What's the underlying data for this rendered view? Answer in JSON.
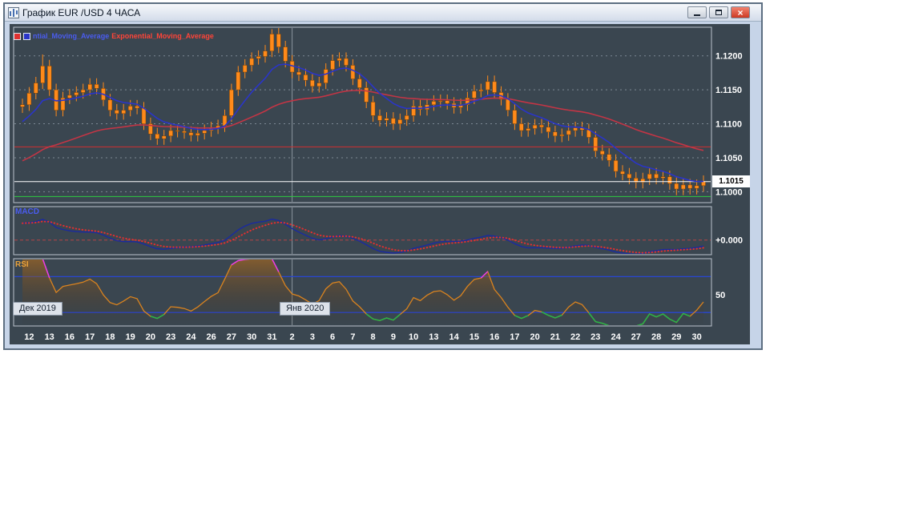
{
  "window": {
    "title": "График EUR /USD 4 ЧАСА"
  },
  "legend": {
    "ema_fast_label": "ntial_Moving_Average",
    "ema_slow_label": "Exponential_Moving_Average"
  },
  "panels": {
    "macd_label": "MACD",
    "macd_axis_label": "+0.000",
    "rsi_label": "RSI",
    "rsi_axis_label": "50"
  },
  "price_axis": {
    "labels": [
      "1.1200",
      "1.1150",
      "1.1100",
      "1.1050",
      "1.1000"
    ],
    "current_price": "1.1015"
  },
  "date_badges": [
    "Дек 2019",
    "Янв 2020"
  ],
  "colors": {
    "background": "#3a4650",
    "panel_border": "#b9c2cc",
    "grid": "#9aa6b2",
    "candle": "#ff8a1a",
    "candle_outline": "#7a4205",
    "ema_fast": "#2a35c8",
    "ema_slow": "#c23545",
    "red_line": "#d23030",
    "white_line": "#ffffff",
    "green_line": "#2ecc40",
    "macd_line": "#1a2aa0",
    "macd_signal": "#e03030",
    "macd_zero": "#cc4444",
    "rsi_line": "#d9831f",
    "rsi_overbought": "#e83ce8",
    "rsi_oversold": "#28b448",
    "rsi_level": "#2846d2",
    "axis_text": "#ffffff"
  },
  "chart_data": {
    "type": "candlestick",
    "title": "EUR/USD 4 часа — свечи с EMA, MACD, RSI",
    "x_labels": [
      "12",
      "13",
      "16",
      "17",
      "18",
      "19",
      "20",
      "23",
      "24",
      "26",
      "27",
      "30",
      "31",
      "2",
      "3",
      "6",
      "7",
      "8",
      "9",
      "10",
      "13",
      "14",
      "15",
      "16",
      "17",
      "20",
      "21",
      "22",
      "23",
      "24",
      "27",
      "28",
      "29",
      "30"
    ],
    "candles_per_label": 3,
    "pre_closes": [
      1.1005,
      1.102,
      1.1038,
      1.1055,
      1.107,
      1.1082,
      1.1095,
      1.1105,
      1.1112,
      1.1118,
      1.1122,
      1.1125
    ],
    "closes": [
      1.1128,
      1.1145,
      1.116,
      1.1185,
      1.115,
      1.112,
      1.1138,
      1.1142,
      1.1146,
      1.115,
      1.1158,
      1.1152,
      1.1135,
      1.112,
      1.1115,
      1.112,
      1.1126,
      1.1123,
      1.11,
      1.1085,
      1.1078,
      1.1082,
      1.109,
      1.1089,
      1.1087,
      1.1083,
      1.1086,
      1.109,
      1.1094,
      1.1097,
      1.1112,
      1.115,
      1.1176,
      1.1186,
      1.1196,
      1.1199,
      1.1207,
      1.1232,
      1.1213,
      1.1192,
      1.1176,
      1.1172,
      1.1164,
      1.1155,
      1.116,
      1.118,
      1.1193,
      1.1196,
      1.1186,
      1.1166,
      1.1153,
      1.1132,
      1.1112,
      1.1105,
      1.1108,
      1.11,
      1.1106,
      1.1112,
      1.1126,
      1.1121,
      1.1128,
      1.1133,
      1.1134,
      1.113,
      1.1124,
      1.1128,
      1.1138,
      1.1148,
      1.115,
      1.1162,
      1.1146,
      1.1136,
      1.112,
      1.11,
      1.109,
      1.1093,
      1.1098,
      1.1095,
      1.1088,
      1.1082,
      1.1084,
      1.109,
      1.1094,
      1.1091,
      1.108,
      1.106,
      1.1055,
      1.1046,
      1.103,
      1.1026,
      1.102,
      1.1014,
      1.1019,
      1.1026,
      1.102,
      1.1022,
      1.1012,
      1.1004,
      1.101,
      1.1005,
      1.1009,
      1.1015
    ],
    "wick_margin": 0.0009,
    "wick_high_overrides": {
      "3": 1.1202,
      "37": 1.1239
    },
    "price_range": [
      1.0984,
      1.1242
    ],
    "gridline_prices": [
      1.12,
      1.115,
      1.11,
      1.105,
      1.1
    ],
    "hlines": [
      {
        "price": 1.1066,
        "color_key": "red_line"
      },
      {
        "price": 1.1015,
        "color_key": "white_line"
      },
      {
        "price": 1.0993,
        "color_key": "green_line"
      }
    ],
    "ema_fast_period": 9,
    "ema_slow_period": 40,
    "macd": {
      "fast": 6,
      "slow": 13,
      "signal": 5,
      "range": [
        -0.0022,
        0.005
      ]
    },
    "rsi": {
      "period": 7,
      "levels": [
        70,
        30
      ],
      "range": [
        15,
        90
      ]
    },
    "month_separator_candle": 40
  }
}
